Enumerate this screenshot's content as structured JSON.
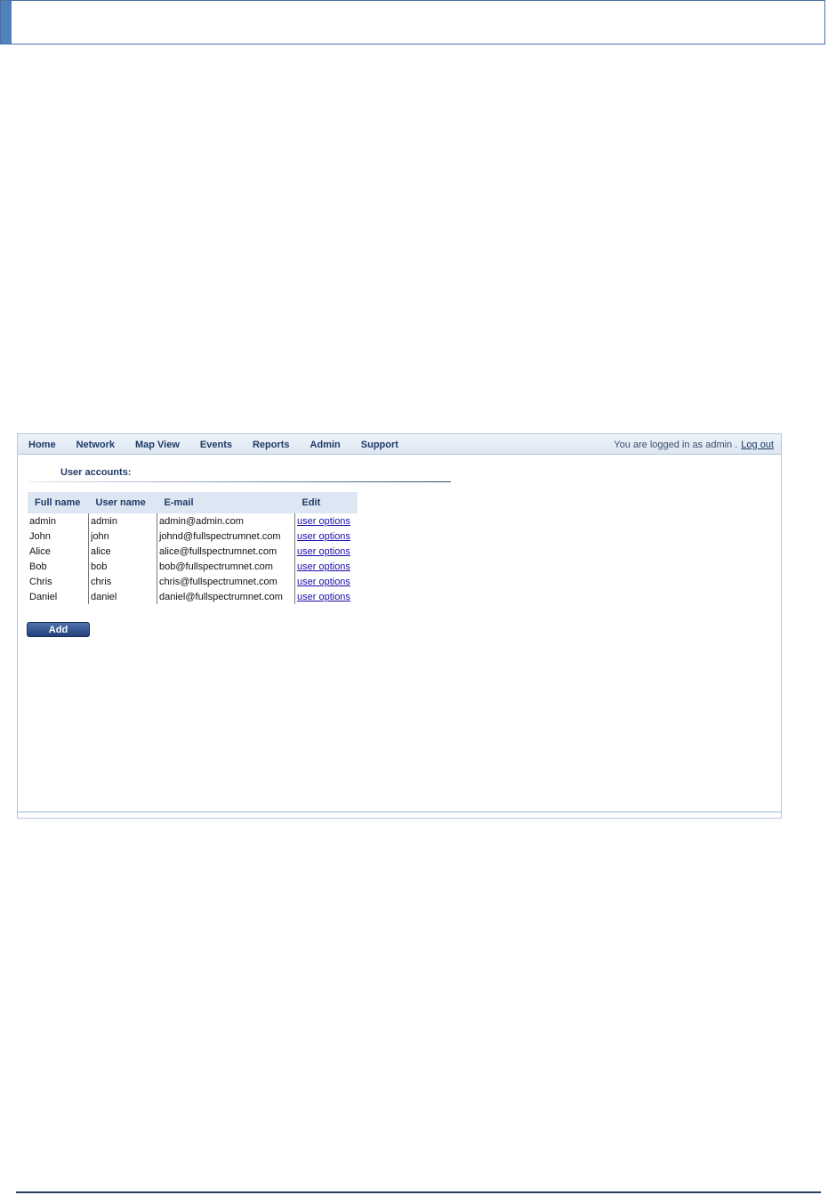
{
  "nav": {
    "items": [
      "Home",
      "Network",
      "Map View",
      "Events",
      "Reports",
      "Admin",
      "Support"
    ],
    "status_text": "You are logged in as admin .",
    "logout_label": "Log out"
  },
  "section": {
    "title": "User accounts:"
  },
  "table": {
    "headers": [
      "Full name",
      "User name",
      "E-mail",
      "Edit"
    ],
    "rows": [
      {
        "full_name": "admin",
        "user_name": "admin",
        "email": "admin@admin.com",
        "edit": "user options"
      },
      {
        "full_name": "John",
        "user_name": "john",
        "email": "johnd@fullspectrumnet.com",
        "edit": "user options"
      },
      {
        "full_name": "Alice",
        "user_name": "alice",
        "email": "alice@fullspectrumnet.com",
        "edit": "user options"
      },
      {
        "full_name": "Bob",
        "user_name": "bob",
        "email": "bob@fullspectrumnet.com",
        "edit": "user options"
      },
      {
        "full_name": "Chris",
        "user_name": "chris",
        "email": "chris@fullspectrumnet.com",
        "edit": "user options"
      },
      {
        "full_name": "Daniel",
        "user_name": "daniel",
        "email": "daniel@fullspectrumnet.com",
        "edit": "user options"
      }
    ]
  },
  "add_button_label": "Add",
  "colors": {
    "nav_text": "#1f3a66",
    "header_bg": "#dde7f3",
    "button_bg": "#22407a",
    "link": "#1a0dab",
    "doc_accent": "#4f81bd"
  }
}
